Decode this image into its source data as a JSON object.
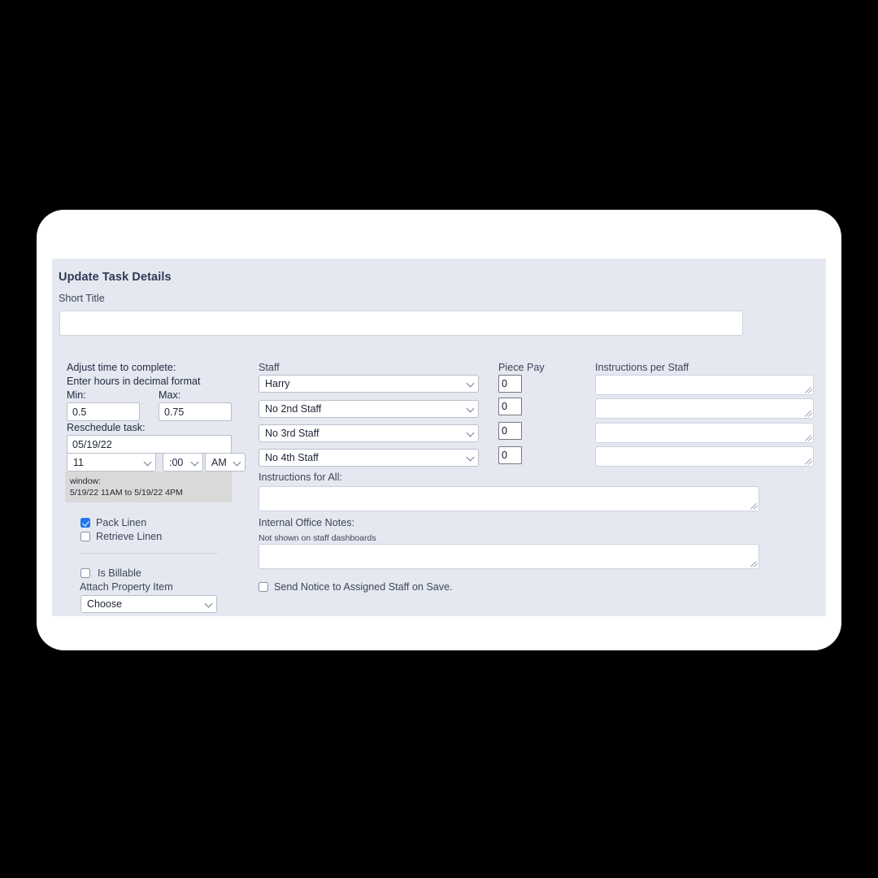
{
  "panel": {
    "title": "Update Task Details",
    "short_title_label": "Short Title",
    "short_title_value": ""
  },
  "time_section": {
    "adjust_label": "Adjust time to complete:",
    "decimal_hint": "Enter hours in decimal format",
    "min_label": "Min:",
    "max_label": "Max:",
    "min_value": "0.5",
    "max_value": "0.75",
    "reschedule_label": "Reschedule task:",
    "date_value": "05/19/22",
    "hour_value": "11",
    "minute_value": ":00",
    "ampm_value": "AM",
    "window_label": "window:",
    "window_value": "5/19/22 11AM to 5/19/22 4PM"
  },
  "linen_options": [
    {
      "label": "Pack Linen",
      "checked": true
    },
    {
      "label": "Retrieve Linen",
      "checked": false
    }
  ],
  "billing": {
    "is_billable_label": "Is Billable",
    "is_billable_checked": false,
    "attach_property_label": "Attach Property Item",
    "attach_property_value": "Choose"
  },
  "staff_section": {
    "header": "Staff",
    "rows": [
      {
        "staff": "Harry",
        "piece_pay": "0",
        "instructions": ""
      },
      {
        "staff": "No 2nd Staff",
        "piece_pay": "0",
        "instructions": ""
      },
      {
        "staff": "No 3rd Staff",
        "piece_pay": "0",
        "instructions": ""
      },
      {
        "staff": "No 4th Staff",
        "piece_pay": "0",
        "instructions": ""
      }
    ],
    "piece_pay_header": "Piece Pay",
    "instructions_header": "Instructions per Staff"
  },
  "notes": {
    "instructions_all_label": "Instructions for All:",
    "instructions_all_value": "",
    "office_notes_label": "Internal Office Notes:",
    "office_notes_sub": "Not shown on staff dashboards",
    "office_notes_value": "",
    "send_notice_label": "Send Notice to Assigned Staff on Save.",
    "send_notice_checked": false
  },
  "colors": {
    "panel_bg": "#e5e8f0",
    "frame_bg": "#ffffff",
    "title_text": "#2f3a55",
    "label_text": "#3b4559",
    "checkbox_accent": "#2176f0",
    "window_bg": "#d9d9d9",
    "page_bg": "#000000"
  }
}
